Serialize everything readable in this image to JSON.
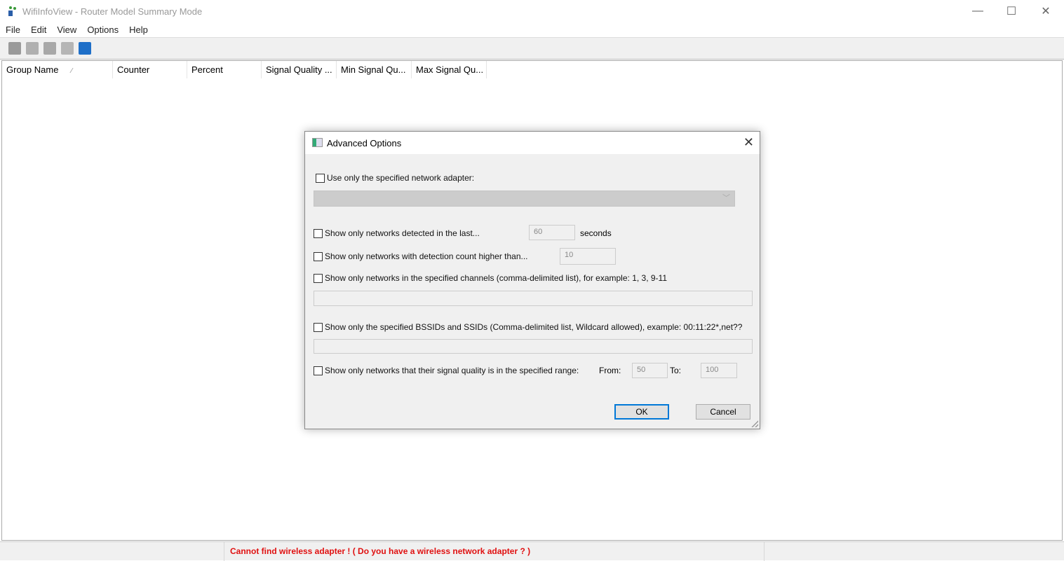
{
  "window": {
    "title": "WifiInfoView  -  Router Model Summary Mode",
    "minimize": "—",
    "maximize": "☐",
    "close": "✕"
  },
  "menu": [
    "File",
    "Edit",
    "View",
    "Options",
    "Help"
  ],
  "toolbar": [
    {
      "icon": "save-icon",
      "color": "#9a9a9a"
    },
    {
      "icon": "copy-icon",
      "color": "#b0b0b0"
    },
    {
      "icon": "properties-icon",
      "color": "#a8a8a8"
    },
    {
      "icon": "find-icon",
      "color": "#b5b5b5"
    },
    {
      "icon": "exit-icon",
      "color": "#1e6fc8"
    }
  ],
  "columns": [
    {
      "label": "Group Name",
      "sort": "⁄",
      "w": 160
    },
    {
      "label": "Counter",
      "w": 106
    },
    {
      "label": "Percent",
      "w": 106
    },
    {
      "label": "Signal Quality ...",
      "w": 107
    },
    {
      "label": "Min Signal Qu...",
      "w": 107
    },
    {
      "label": "Max Signal Qu...",
      "w": 107
    }
  ],
  "status": {
    "panel1": "",
    "message": "Cannot find wireless adapter !    ( Do you have a wireless network adapter ? )",
    "panel3": "",
    "color": "#e01010"
  },
  "dialog": {
    "title": "Advanced Options",
    "close": "✕",
    "adapter_label": "Use only the specified network adapter:",
    "adapter_value": "",
    "adapter_arrow": "﹀",
    "last_label": "Show only networks detected in the last...",
    "last_value": "60",
    "last_unit": "seconds",
    "count_label": "Show only networks with detection count higher than...",
    "count_value": "10",
    "channels_label": "Show only networks in the specified channels (comma-delimited list), for example: 1, 3, 9-11",
    "channels_value": "",
    "bssid_label": "Show only the specified BSSIDs and SSIDs (Comma-delimited list, Wildcard allowed), example: 00:11:22*,net??",
    "bssid_value": "",
    "range_label": "Show only networks that their signal quality is in the specified range:",
    "from_label": "From:",
    "from_value": "50",
    "to_label": "To:",
    "to_value": "100",
    "ok": "OK",
    "cancel": "Cancel"
  }
}
